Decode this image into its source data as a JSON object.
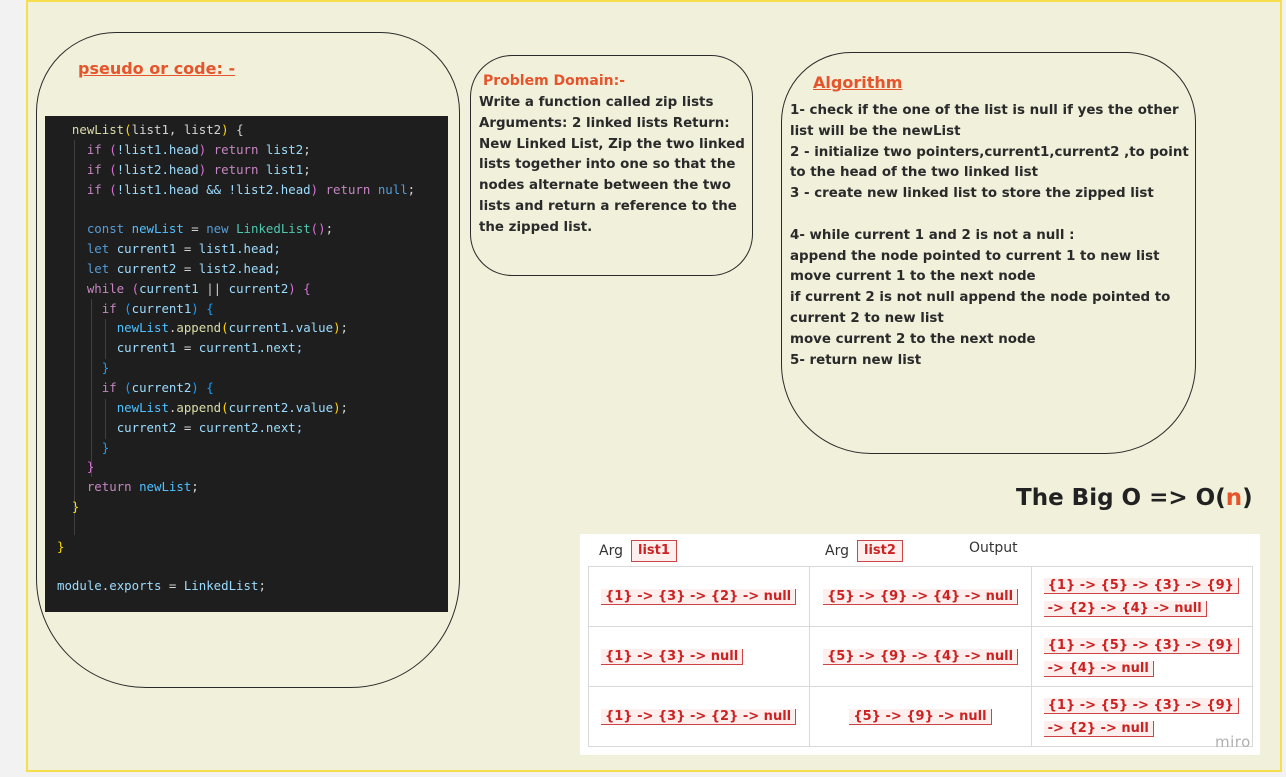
{
  "board": {
    "watermark": "miro"
  },
  "pseudo": {
    "title": "pseudo or code: -"
  },
  "code": {
    "lines": [
      [
        [
          "  newList",
          "#dcdcaa"
        ],
        [
          "(",
          "#ffd700"
        ],
        [
          "list1",
          "#d4d4d4"
        ],
        [
          ", list2",
          "#d4d4d4"
        ],
        [
          ")",
          "#ffd700"
        ],
        [
          " {",
          "#d4d4d4"
        ]
      ],
      [
        [
          "    ",
          ""
        ],
        [
          "if",
          "#c586c0"
        ],
        [
          " (",
          "#da70d6"
        ],
        [
          "!list1",
          "#9cdcfe"
        ],
        [
          ".head",
          "#9cdcfe"
        ],
        [
          ")",
          "#da70d6"
        ],
        [
          " return ",
          "#c586c0"
        ],
        [
          "list2",
          "#9cdcfe"
        ],
        [
          ";",
          "#d4d4d4"
        ]
      ],
      [
        [
          "    ",
          ""
        ],
        [
          "if",
          "#c586c0"
        ],
        [
          " (",
          "#da70d6"
        ],
        [
          "!list2",
          "#9cdcfe"
        ],
        [
          ".head",
          "#9cdcfe"
        ],
        [
          ")",
          "#da70d6"
        ],
        [
          " return ",
          "#c586c0"
        ],
        [
          "list1",
          "#9cdcfe"
        ],
        [
          ";",
          "#d4d4d4"
        ]
      ],
      [
        [
          "    ",
          ""
        ],
        [
          "if",
          "#c586c0"
        ],
        [
          " (",
          "#da70d6"
        ],
        [
          "!list1.head && !list2.head",
          "#9cdcfe"
        ],
        [
          ")",
          "#da70d6"
        ],
        [
          " return ",
          "#c586c0"
        ],
        [
          "null",
          "#569cd6"
        ],
        [
          ";",
          "#d4d4d4"
        ]
      ],
      [
        [
          "",
          ""
        ]
      ],
      [
        [
          "    ",
          ""
        ],
        [
          "const ",
          "#569cd6"
        ],
        [
          "newList",
          "#4fc1ff"
        ],
        [
          " = ",
          "#d4d4d4"
        ],
        [
          "new ",
          "#569cd6"
        ],
        [
          "LinkedList",
          "#4ec9b0"
        ],
        [
          "()",
          "#da70d6"
        ],
        [
          ";",
          "#d4d4d4"
        ]
      ],
      [
        [
          "    ",
          ""
        ],
        [
          "let ",
          "#569cd6"
        ],
        [
          "current1",
          "#9cdcfe"
        ],
        [
          " = ",
          "#d4d4d4"
        ],
        [
          "list1",
          "#9cdcfe"
        ],
        [
          ".head;",
          "#9cdcfe"
        ]
      ],
      [
        [
          "    ",
          ""
        ],
        [
          "let ",
          "#569cd6"
        ],
        [
          "current2",
          "#9cdcfe"
        ],
        [
          " = ",
          "#d4d4d4"
        ],
        [
          "list2",
          "#9cdcfe"
        ],
        [
          ".head;",
          "#9cdcfe"
        ]
      ],
      [
        [
          "    ",
          ""
        ],
        [
          "while",
          "#c586c0"
        ],
        [
          " (",
          "#da70d6"
        ],
        [
          "current1",
          "#9cdcfe"
        ],
        [
          " || ",
          "#d4d4d4"
        ],
        [
          "current2",
          "#9cdcfe"
        ],
        [
          ")",
          "#da70d6"
        ],
        [
          " {",
          "#da70d6"
        ]
      ],
      [
        [
          "      ",
          ""
        ],
        [
          "if",
          "#c586c0"
        ],
        [
          " (",
          "#179fff"
        ],
        [
          "current1",
          "#9cdcfe"
        ],
        [
          ")",
          "#179fff"
        ],
        [
          " {",
          "#179fff"
        ]
      ],
      [
        [
          "        ",
          ""
        ],
        [
          "newList",
          "#4fc1ff"
        ],
        [
          ".",
          "#d4d4d4"
        ],
        [
          "append",
          "#dcdcaa"
        ],
        [
          "(",
          "#ffd700"
        ],
        [
          "current1",
          "#9cdcfe"
        ],
        [
          ".value",
          "#9cdcfe"
        ],
        [
          ")",
          "#ffd700"
        ],
        [
          ";",
          "#d4d4d4"
        ]
      ],
      [
        [
          "        ",
          ""
        ],
        [
          "current1",
          "#9cdcfe"
        ],
        [
          " = ",
          "#d4d4d4"
        ],
        [
          "current1",
          "#9cdcfe"
        ],
        [
          ".next;",
          "#9cdcfe"
        ]
      ],
      [
        [
          "      ",
          ""
        ],
        [
          "}",
          "#179fff"
        ]
      ],
      [
        [
          "      ",
          ""
        ],
        [
          "if",
          "#c586c0"
        ],
        [
          " (",
          "#179fff"
        ],
        [
          "current2",
          "#9cdcfe"
        ],
        [
          ")",
          "#179fff"
        ],
        [
          " {",
          "#179fff"
        ]
      ],
      [
        [
          "        ",
          ""
        ],
        [
          "newList",
          "#4fc1ff"
        ],
        [
          ".",
          "#d4d4d4"
        ],
        [
          "append",
          "#dcdcaa"
        ],
        [
          "(",
          "#ffd700"
        ],
        [
          "current2",
          "#9cdcfe"
        ],
        [
          ".value",
          "#9cdcfe"
        ],
        [
          ")",
          "#ffd700"
        ],
        [
          ";",
          "#d4d4d4"
        ]
      ],
      [
        [
          "        ",
          ""
        ],
        [
          "current2",
          "#9cdcfe"
        ],
        [
          " = ",
          "#d4d4d4"
        ],
        [
          "current2",
          "#9cdcfe"
        ],
        [
          ".next;",
          "#9cdcfe"
        ]
      ],
      [
        [
          "      ",
          ""
        ],
        [
          "}",
          "#179fff"
        ]
      ],
      [
        [
          "    ",
          ""
        ],
        [
          "}",
          "#da70d6"
        ]
      ],
      [
        [
          "    ",
          ""
        ],
        [
          "return ",
          "#c586c0"
        ],
        [
          "newList",
          "#4fc1ff"
        ],
        [
          ";",
          "#d4d4d4"
        ]
      ],
      [
        [
          "  ",
          ""
        ],
        [
          "}",
          "#ffd700"
        ]
      ],
      [
        [
          "",
          ""
        ]
      ],
      [
        [
          "",
          ""
        ],
        [
          "}",
          "#ffd700"
        ]
      ],
      [
        [
          "",
          ""
        ]
      ],
      [
        [
          "module",
          "#9cdcfe"
        ],
        [
          ".",
          "#d4d4d4"
        ],
        [
          "exports",
          "#9cdcfe"
        ],
        [
          " = ",
          "#d4d4d4"
        ],
        [
          "LinkedList",
          "#9cdcfe"
        ],
        [
          ";",
          "#d4d4d4"
        ]
      ]
    ]
  },
  "problem": {
    "title": "Problem Domain:-",
    "text": "Write a function called zip lists Arguments: 2 linked lists Return: New Linked List, Zip the two linked lists together into one so that the nodes alternate between the two lists and return a reference to the the zipped list."
  },
  "algorithm": {
    "title": "Algorithm",
    "lines": [
      "1- check if the one of the list is null if yes the other list will be the newList",
      "2 - initialize two pointers,current1,current2 ,to point to the head of the two linked list",
      "3 - create new linked list to store the zipped list",
      "",
      "4- while current 1 and 2 is not a null :",
      "append the node pointed to current 1 to new list",
      "move current 1 to the next node",
      "if current 2 is not null append the node pointed to current 2 to new list",
      "move current 2 to the next node",
      "5- return new list"
    ]
  },
  "bigo": {
    "prefix": "The Big O => O(",
    "n": "n",
    "suffix": ")"
  },
  "table": {
    "headers": [
      {
        "label": "Arg",
        "tag": "list1"
      },
      {
        "label": "Arg",
        "tag": "list2"
      },
      {
        "label": "Output",
        "tag": ""
      }
    ],
    "rows": [
      [
        "{1} -> {3} -> {2} -> null",
        "{5} -> {9} -> {4} -> null",
        "{1} -> {5} -> {3} -> {9} -> {2} -> {4} -> null"
      ],
      [
        "{1} -> {3} -> null",
        "{5} -> {9} -> {4} -> null",
        "{1} -> {5} -> {3} -> {9} -> {4} -> null"
      ],
      [
        "{1} -> {3} -> {2} -> null",
        "{5} -> {9} -> null",
        "{1} -> {5} -> {3} -> {9} -> {2} -> null"
      ]
    ]
  }
}
